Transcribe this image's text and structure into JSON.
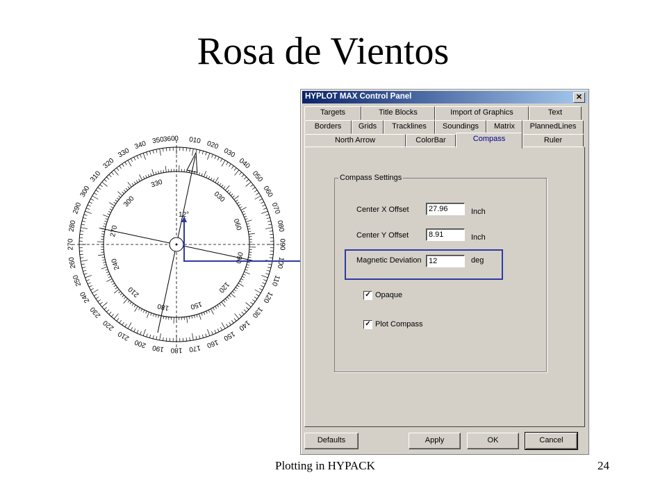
{
  "slide": {
    "title": "Rosa de Vientos",
    "footer_left": "Plotting in HYPACK",
    "footer_right": "24"
  },
  "compass": {
    "deviation_label": "12°",
    "outer_labels": [
      "0",
      "010",
      "020",
      "030",
      "040",
      "050",
      "060",
      "070",
      "080",
      "090",
      "100",
      "110",
      "120",
      "130",
      "140",
      "150",
      "160",
      "170",
      "180",
      "190",
      "200",
      "210",
      "220",
      "230",
      "240",
      "250",
      "260",
      "270",
      "280",
      "290",
      "300",
      "310",
      "320",
      "330",
      "340",
      "350",
      "360"
    ],
    "inner_labels": [
      "330",
      "030",
      "060",
      "090",
      "120",
      "150",
      "180",
      "210",
      "240",
      "270",
      "300"
    ],
    "colors": {
      "lines": "#000000",
      "pointer": "#2d3aa0"
    }
  },
  "dialog": {
    "title": "HYPLOT MAX Control Panel",
    "close_label": "✕",
    "tabs_row1": [
      "Targets",
      "Title Blocks",
      "Import of Graphics",
      "Text"
    ],
    "tabs_row2": [
      "Borders",
      "Grids",
      "Tracklines",
      "Soundings",
      "Matrix",
      "PlannedLines"
    ],
    "tabs_row3": [
      "North Arrow",
      "ColorBar",
      "Compass",
      "Ruler"
    ],
    "group_title": "Compass Settings",
    "center_x": {
      "label": "Center X Offset",
      "value": "27.96",
      "unit": "Inch"
    },
    "center_y": {
      "label": "Center Y Offset",
      "value": "8.91",
      "unit": "Inch"
    },
    "magnetic": {
      "label": "Magnetic Deviation",
      "value": "12",
      "unit": "deg"
    },
    "opaque": {
      "label": "Opaque",
      "checked": true
    },
    "plot_compass": {
      "label": "Plot Compass",
      "checked": true
    },
    "buttons": {
      "defaults": "Defaults",
      "apply": "Apply",
      "ok": "OK",
      "cancel": "Cancel"
    },
    "highlight_color": "#2d3aa0"
  }
}
